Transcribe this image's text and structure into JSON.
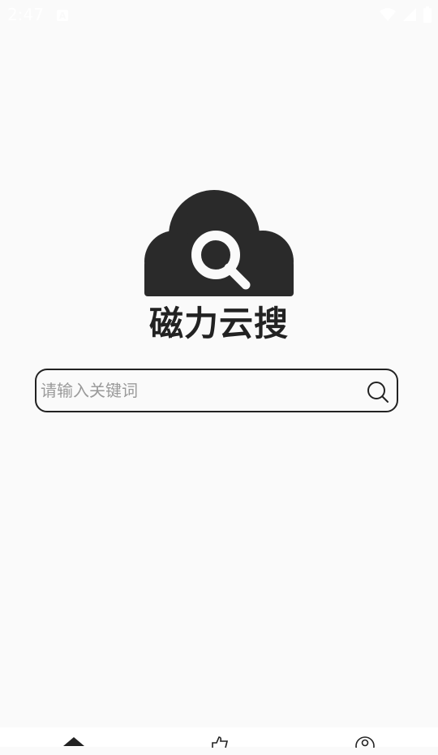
{
  "status_bar": {
    "time": "2:47",
    "icons": [
      "notification-icon",
      "wifi-icon",
      "cellular-signal-icon",
      "battery-icon"
    ]
  },
  "logo": {
    "text": "磁力云搜",
    "icon": "cloud-search-icon"
  },
  "search": {
    "placeholder": "请输入关键词",
    "value": "",
    "button_icon": "search-icon"
  },
  "bottom_nav": {
    "items": [
      {
        "icon": "home-icon",
        "active": true
      },
      {
        "icon": "thumbs-up-icon",
        "active": false
      },
      {
        "icon": "user-icon",
        "active": false
      }
    ]
  },
  "colors": {
    "background": "#fafafa",
    "primary": "#222222",
    "placeholder": "#9a9a9a"
  }
}
